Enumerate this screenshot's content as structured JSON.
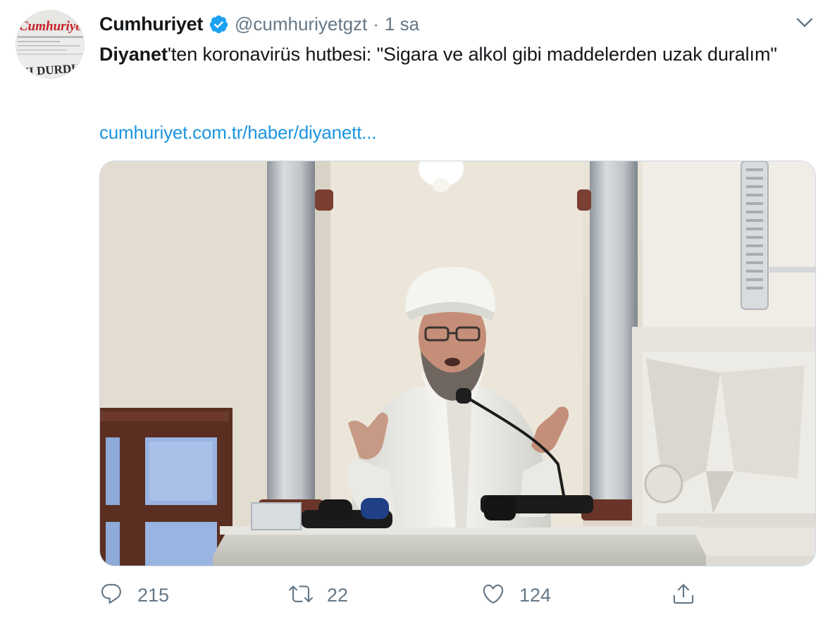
{
  "author": {
    "name": "Cumhuriyet",
    "handle": "@cumhuriyetgzt",
    "separator": "·",
    "time": "1 sa",
    "verified": true,
    "avatar_logo_text": "Cumhuriyet",
    "avatar_headline_text": "YI DURDURD"
  },
  "tweet": {
    "bold_lead": "Diyanet",
    "text_rest": "'ten koronavirüs hutbesi: \"Sigara ve alkol gibi maddelerden uzak duralım\"",
    "link": "cumhuriyet.com.tr/haber/diyanett..."
  },
  "media": {
    "icon": "photo"
  },
  "actions": {
    "reply_count": "215",
    "retweet_count": "22",
    "like_count": "124"
  },
  "colors": {
    "link": "#1b95e0",
    "secondary": "#657786",
    "verified": "#1da1f2"
  }
}
